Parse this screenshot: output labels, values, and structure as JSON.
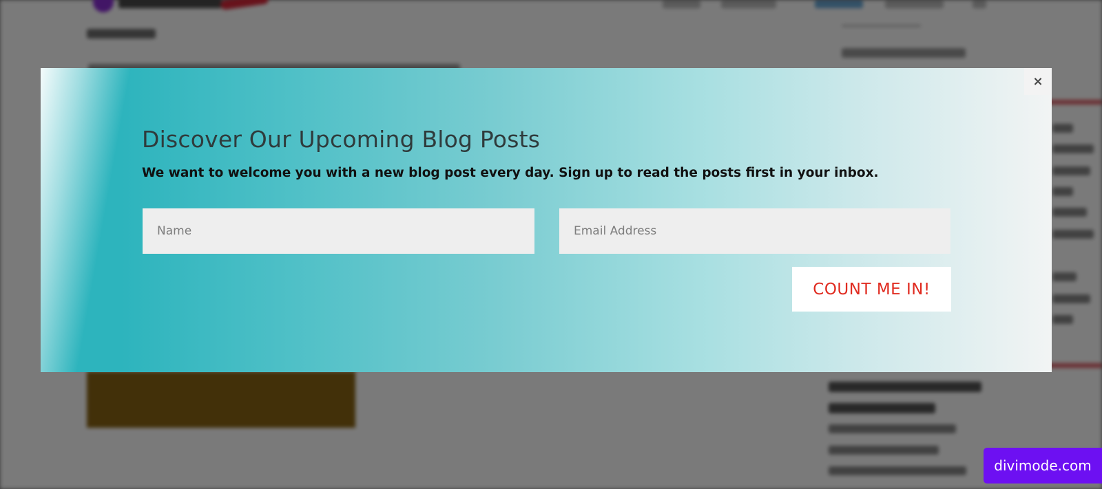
{
  "popup": {
    "close_label": "×",
    "title": "Discover Our Upcoming Blog Posts",
    "subtitle": "We want to welcome you with a new blog post every day. Sign up to read the posts first in your inbox.",
    "name_placeholder": "Name",
    "name_value": "",
    "email_placeholder": "Email Address",
    "email_value": "",
    "submit_label": "COUNT ME IN!"
  },
  "watermark": {
    "text": "divimode.com"
  },
  "colors": {
    "gradient_start": "#2db4bd",
    "gradient_end": "#f2f4f4",
    "submit_text": "#e02b20",
    "badge_background": "#6d10f2"
  }
}
